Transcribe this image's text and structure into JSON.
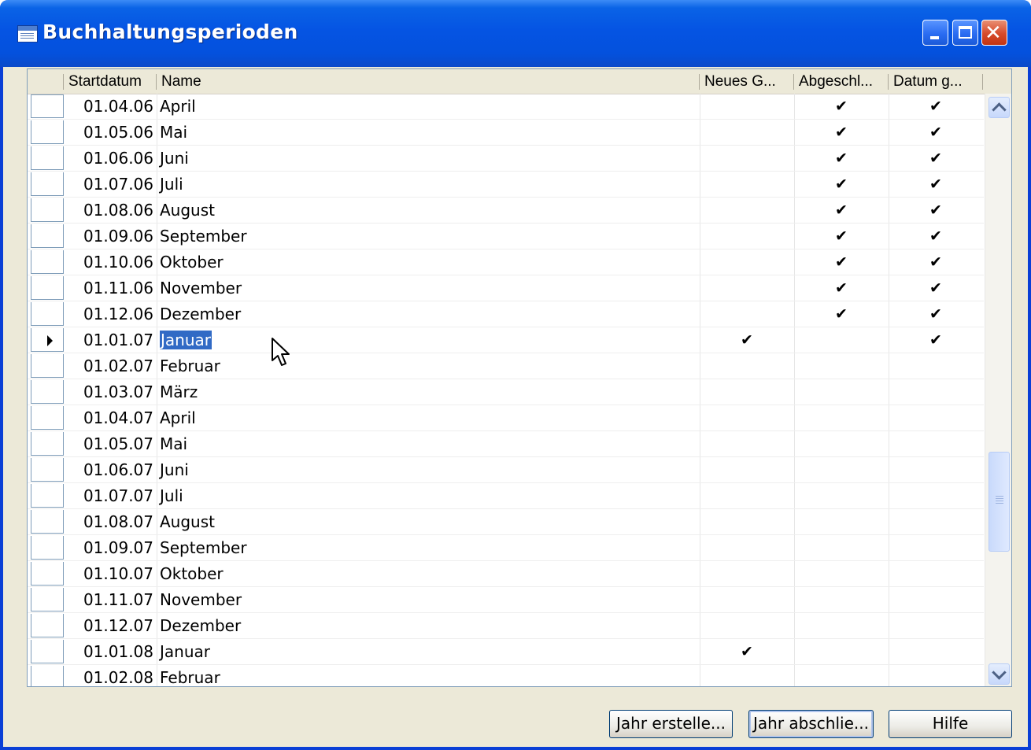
{
  "window": {
    "title": "Buchhaltungsperioden",
    "icon": "table-icon"
  },
  "title_buttons": {
    "minimize": "minimize-icon",
    "maximize": "maximize-icon",
    "close": "close-icon",
    "close_glyph": "✕"
  },
  "columns": {
    "startdatum": "Startdatum",
    "name": "Name",
    "neues": "Neues G...",
    "abgeschl": "Abgeschl...",
    "datum": "Datum g..."
  },
  "check_glyph": "✔",
  "rows": [
    {
      "date": "01.04.06",
      "name": "April",
      "neues": false,
      "abgeschl": true,
      "datum": true
    },
    {
      "date": "01.05.06",
      "name": "Mai",
      "neues": false,
      "abgeschl": true,
      "datum": true
    },
    {
      "date": "01.06.06",
      "name": "Juni",
      "neues": false,
      "abgeschl": true,
      "datum": true
    },
    {
      "date": "01.07.06",
      "name": "Juli",
      "neues": false,
      "abgeschl": true,
      "datum": true
    },
    {
      "date": "01.08.06",
      "name": "August",
      "neues": false,
      "abgeschl": true,
      "datum": true
    },
    {
      "date": "01.09.06",
      "name": "September",
      "neues": false,
      "abgeschl": true,
      "datum": true
    },
    {
      "date": "01.10.06",
      "name": "Oktober",
      "neues": false,
      "abgeschl": true,
      "datum": true
    },
    {
      "date": "01.11.06",
      "name": "November",
      "neues": false,
      "abgeschl": true,
      "datum": true
    },
    {
      "date": "01.12.06",
      "name": "Dezember",
      "neues": false,
      "abgeschl": true,
      "datum": true
    },
    {
      "date": "01.01.07",
      "name": "Januar",
      "neues": true,
      "abgeschl": false,
      "datum": true,
      "current": true
    },
    {
      "date": "01.02.07",
      "name": "Februar",
      "neues": false,
      "abgeschl": false,
      "datum": false
    },
    {
      "date": "01.03.07",
      "name": "März",
      "neues": false,
      "abgeschl": false,
      "datum": false
    },
    {
      "date": "01.04.07",
      "name": "April",
      "neues": false,
      "abgeschl": false,
      "datum": false
    },
    {
      "date": "01.05.07",
      "name": "Mai",
      "neues": false,
      "abgeschl": false,
      "datum": false
    },
    {
      "date": "01.06.07",
      "name": "Juni",
      "neues": false,
      "abgeschl": false,
      "datum": false
    },
    {
      "date": "01.07.07",
      "name": "Juli",
      "neues": false,
      "abgeschl": false,
      "datum": false
    },
    {
      "date": "01.08.07",
      "name": "August",
      "neues": false,
      "abgeschl": false,
      "datum": false
    },
    {
      "date": "01.09.07",
      "name": "September",
      "neues": false,
      "abgeschl": false,
      "datum": false
    },
    {
      "date": "01.10.07",
      "name": "Oktober",
      "neues": false,
      "abgeschl": false,
      "datum": false
    },
    {
      "date": "01.11.07",
      "name": "November",
      "neues": false,
      "abgeschl": false,
      "datum": false
    },
    {
      "date": "01.12.07",
      "name": "Dezember",
      "neues": false,
      "abgeschl": false,
      "datum": false
    },
    {
      "date": "01.01.08",
      "name": "Januar",
      "neues": true,
      "abgeschl": false,
      "datum": false
    },
    {
      "date": "01.02.08",
      "name": "Februar",
      "neues": false,
      "abgeschl": false,
      "datum": false
    }
  ],
  "buttons": {
    "jahr_erstellen": "Jahr erstelle...",
    "jahr_abschliessen": "Jahr abschlie...",
    "hilfe": "Hilfe"
  },
  "colors": {
    "title_bar": "#0554e3",
    "selection": "#316ac5",
    "dialog_bg": "#ece9d8",
    "close_button": "#d64a2a"
  }
}
